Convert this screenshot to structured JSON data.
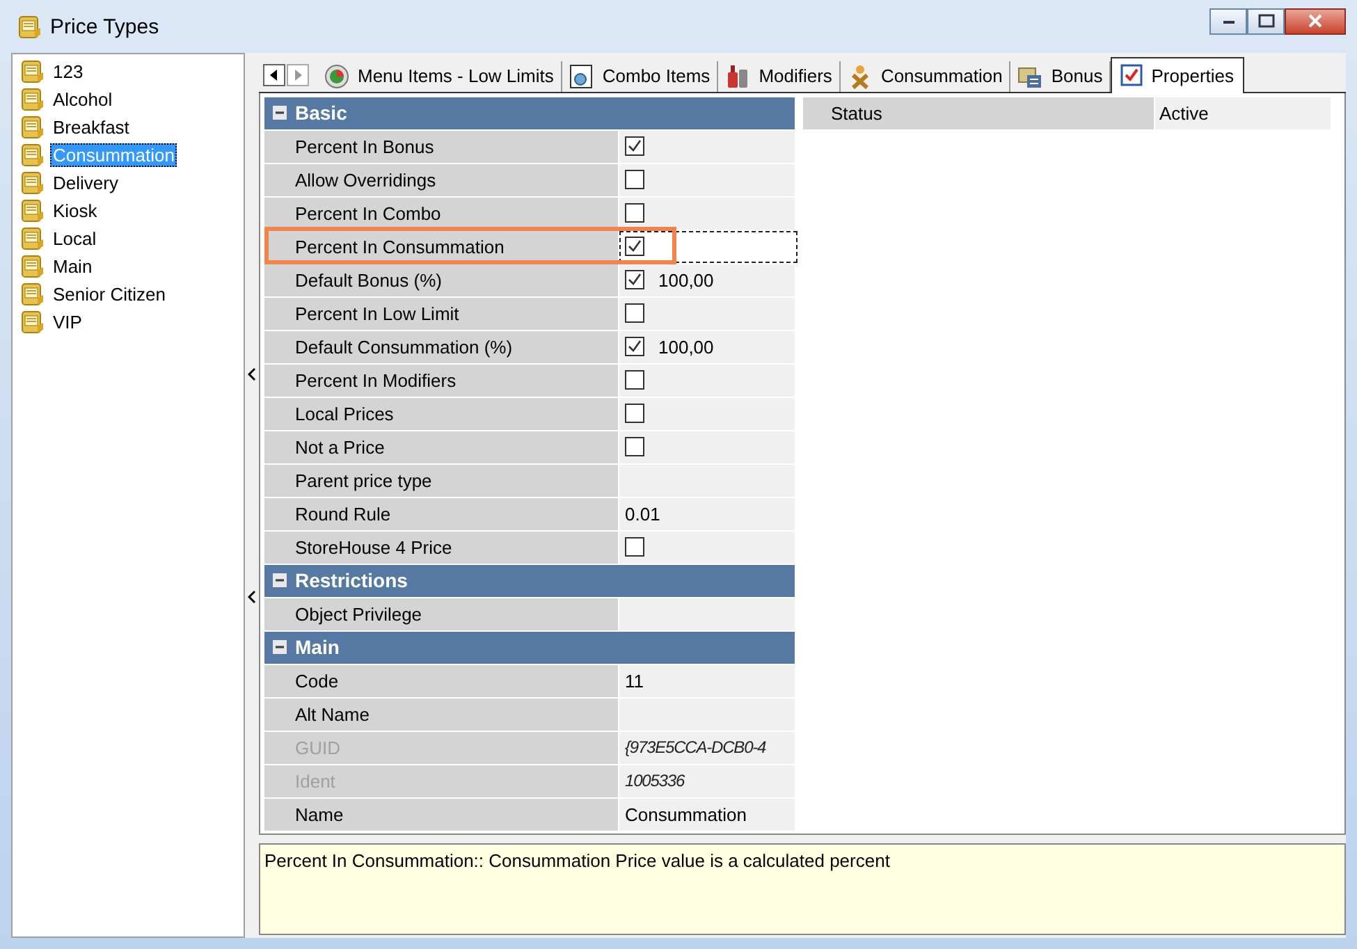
{
  "window": {
    "title": "Price Types"
  },
  "price_types": [
    {
      "label": "123",
      "selected": false
    },
    {
      "label": "Alcohol",
      "selected": false
    },
    {
      "label": "Breakfast",
      "selected": false
    },
    {
      "label": "Consummation",
      "selected": true
    },
    {
      "label": "Delivery",
      "selected": false
    },
    {
      "label": "Kiosk",
      "selected": false
    },
    {
      "label": "Local",
      "selected": false
    },
    {
      "label": "Main",
      "selected": false
    },
    {
      "label": "Senior Citizen",
      "selected": false
    },
    {
      "label": "VIP",
      "selected": false
    }
  ],
  "tabs": [
    {
      "label": "Menu Items - Low Limits",
      "selected": false
    },
    {
      "label": "Combo Items",
      "selected": false
    },
    {
      "label": "Modifiers",
      "selected": false
    },
    {
      "label": "Consummation",
      "selected": false
    },
    {
      "label": "Bonus",
      "selected": false
    },
    {
      "label": "Properties",
      "selected": true
    }
  ],
  "highlight_selected": true,
  "sections": [
    {
      "title": "Basic",
      "expanded": true,
      "rows": [
        {
          "label": "Percent In Bonus",
          "kind": "checkbox",
          "checked": true,
          "disabled": false,
          "selected": false
        },
        {
          "label": "Allow Overridings",
          "kind": "checkbox",
          "checked": false,
          "disabled": false,
          "selected": false
        },
        {
          "label": "Percent In Combo",
          "kind": "checkbox",
          "checked": false,
          "disabled": false,
          "selected": false
        },
        {
          "label": "Percent In Consummation",
          "kind": "checkbox",
          "checked": true,
          "disabled": false,
          "selected": true
        },
        {
          "label": "Default Bonus (%)",
          "kind": "checkbox",
          "checked": true,
          "value": "100,00",
          "disabled": false,
          "selected": false
        },
        {
          "label": "Percent In Low Limit",
          "kind": "checkbox",
          "checked": false,
          "disabled": false,
          "selected": false
        },
        {
          "label": "Default Consummation (%)",
          "kind": "checkbox",
          "checked": true,
          "value": "100,00",
          "disabled": false,
          "selected": false
        },
        {
          "label": "Percent In Modifiers",
          "kind": "checkbox",
          "checked": false,
          "disabled": false,
          "selected": false
        },
        {
          "label": "Local Prices",
          "kind": "checkbox",
          "checked": false,
          "disabled": false,
          "selected": false
        },
        {
          "label": "Not a Price",
          "kind": "checkbox",
          "checked": false,
          "disabled": false,
          "selected": false
        },
        {
          "label": "Parent price type",
          "kind": "text",
          "disabled": false,
          "selected": false
        },
        {
          "label": "Round Rule",
          "kind": "text",
          "value": "0.01",
          "disabled": false,
          "selected": false
        },
        {
          "label": "StoreHouse 4 Price",
          "kind": "checkbox",
          "checked": false,
          "disabled": false,
          "selected": false
        }
      ]
    },
    {
      "title": "Restrictions",
      "expanded": true,
      "rows": [
        {
          "label": "Object Privilege",
          "kind": "text",
          "disabled": false,
          "selected": false
        }
      ]
    },
    {
      "title": "Main",
      "expanded": true,
      "rows": [
        {
          "label": "Code",
          "kind": "text",
          "value": "11",
          "disabled": false,
          "selected": false
        },
        {
          "label": "Alt Name",
          "kind": "text",
          "disabled": false,
          "selected": false
        },
        {
          "label": "GUID",
          "kind": "text",
          "value": "{973E5CCA-DCB0-4",
          "disabled": true,
          "selected": false
        },
        {
          "label": "Ident",
          "kind": "text",
          "value": "1005336",
          "disabled": true,
          "selected": false
        },
        {
          "label": "Name",
          "kind": "text",
          "value": "Consummation",
          "disabled": false,
          "selected": false
        }
      ]
    }
  ],
  "status": {
    "label": "Status",
    "value": "Active"
  },
  "description": "Percent In Consummation:: Consummation Price value is a calculated percent"
}
